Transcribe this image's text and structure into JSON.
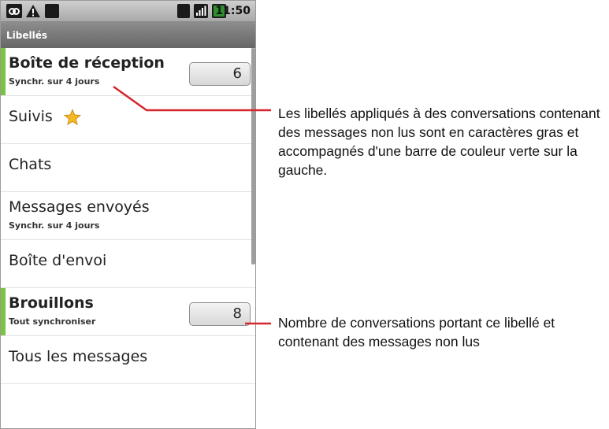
{
  "status_bar": {
    "time": "11:50",
    "icons": [
      "voicemail-icon",
      "warning-icon",
      "usb-icon",
      "wifi-icon",
      "signal-icon",
      "battery-icon"
    ]
  },
  "app": {
    "title": "Libellés"
  },
  "labels": [
    {
      "name": "Boîte de réception",
      "sub": "Synchr. sur 4 jours",
      "count": "6",
      "unread": true
    },
    {
      "name": "Suivis",
      "icon": "star-icon"
    },
    {
      "name": "Chats"
    },
    {
      "name": "Messages envoyés",
      "sub": "Synchr. sur 4 jours"
    },
    {
      "name": "Boîte d'envoi"
    },
    {
      "name": "Brouillons",
      "sub": "Tout synchroniser",
      "count": "8",
      "unread": true
    },
    {
      "name": "Tous les messages"
    }
  ],
  "annotations": {
    "unread_style": "Les libellés appliqués à des conversations contenant des messages non lus sont en caractères gras et accompagnés d'une barre de couleur verte sur la gauche.",
    "unread_count": "Nombre de conversations portant ce libellé et contenant des messages non lus"
  },
  "colors": {
    "unread_bar": "#7dc243",
    "leader_line": "#d6262e",
    "title_bar": "#777777"
  }
}
